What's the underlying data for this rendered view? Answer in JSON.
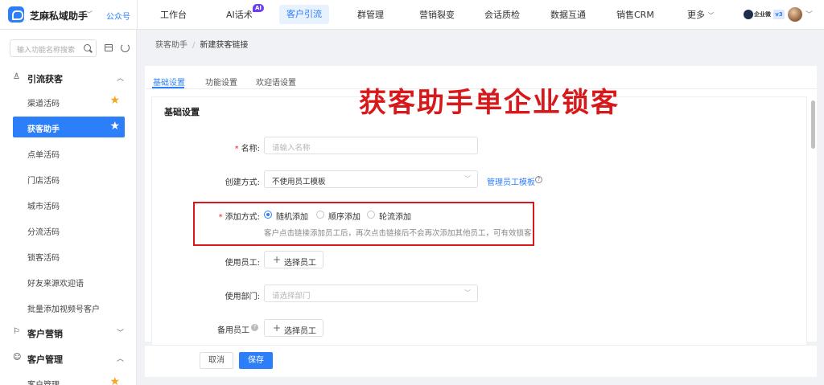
{
  "header": {
    "app_name": "芝麻私域助手",
    "gzh_link": "公众号",
    "ai_badge": "AI",
    "nav": [
      "工作台",
      "AI话术",
      "客户引流",
      "群管理",
      "营销裂变",
      "会话质检",
      "数据互通",
      "销售CRM",
      "更多"
    ],
    "active_nav": "客户引流",
    "wecom_label": "企业微",
    "version_badge": "v3"
  },
  "sidebar": {
    "search_placeholder": "输入功能名称搜索",
    "groups": [
      {
        "label": "引流获客",
        "icon": "user-add-icon",
        "expanded": true,
        "items": [
          {
            "label": "渠道活码",
            "starred": true
          },
          {
            "label": "获客助手",
            "starred": true,
            "active": true
          },
          {
            "label": "点单活码"
          },
          {
            "label": "门店活码"
          },
          {
            "label": "城市活码"
          },
          {
            "label": "分流活码"
          },
          {
            "label": "锁客活码"
          },
          {
            "label": "好友来源欢迎语"
          },
          {
            "label": "批量添加视频号客户"
          }
        ]
      },
      {
        "label": "客户营销",
        "icon": "flag-icon",
        "expanded": false
      },
      {
        "label": "客户管理",
        "icon": "customer-icon",
        "expanded": true,
        "items": [
          {
            "label": "客户管理",
            "starred": true
          }
        ]
      }
    ]
  },
  "breadcrumb": [
    "获客助手",
    "新建获客链接"
  ],
  "tabs": [
    "基础设置",
    "功能设置",
    "欢迎语设置"
  ],
  "active_tab": "基础设置",
  "overlay_title": "获客助手单企业锁客",
  "form": {
    "section_title": "基础设置",
    "name": {
      "label": "名称:",
      "placeholder": "请输入名称"
    },
    "create_method": {
      "label": "创建方式:",
      "value": "不使用员工模板",
      "link": "管理员工模板"
    },
    "add_method": {
      "label": "添加方式:",
      "options": [
        "随机添加",
        "顺序添加",
        "轮流添加"
      ],
      "selected": "随机添加",
      "hint": "客户点击链接添加员工后，再次点击链接后不会再次添加其他员工，可有效锁客"
    },
    "use_staff": {
      "label": "使用员工:",
      "button": "选择员工"
    },
    "use_dept": {
      "label": "使用部门:",
      "placeholder": "请选择部门"
    },
    "backup_staff": {
      "label": "备用员工",
      "button": "选择员工"
    }
  },
  "footer": {
    "cancel": "取消",
    "save": "保存"
  },
  "colors": {
    "accent": "#2d7ff9",
    "highlight": "#d7191c",
    "star": "#f5a623"
  }
}
